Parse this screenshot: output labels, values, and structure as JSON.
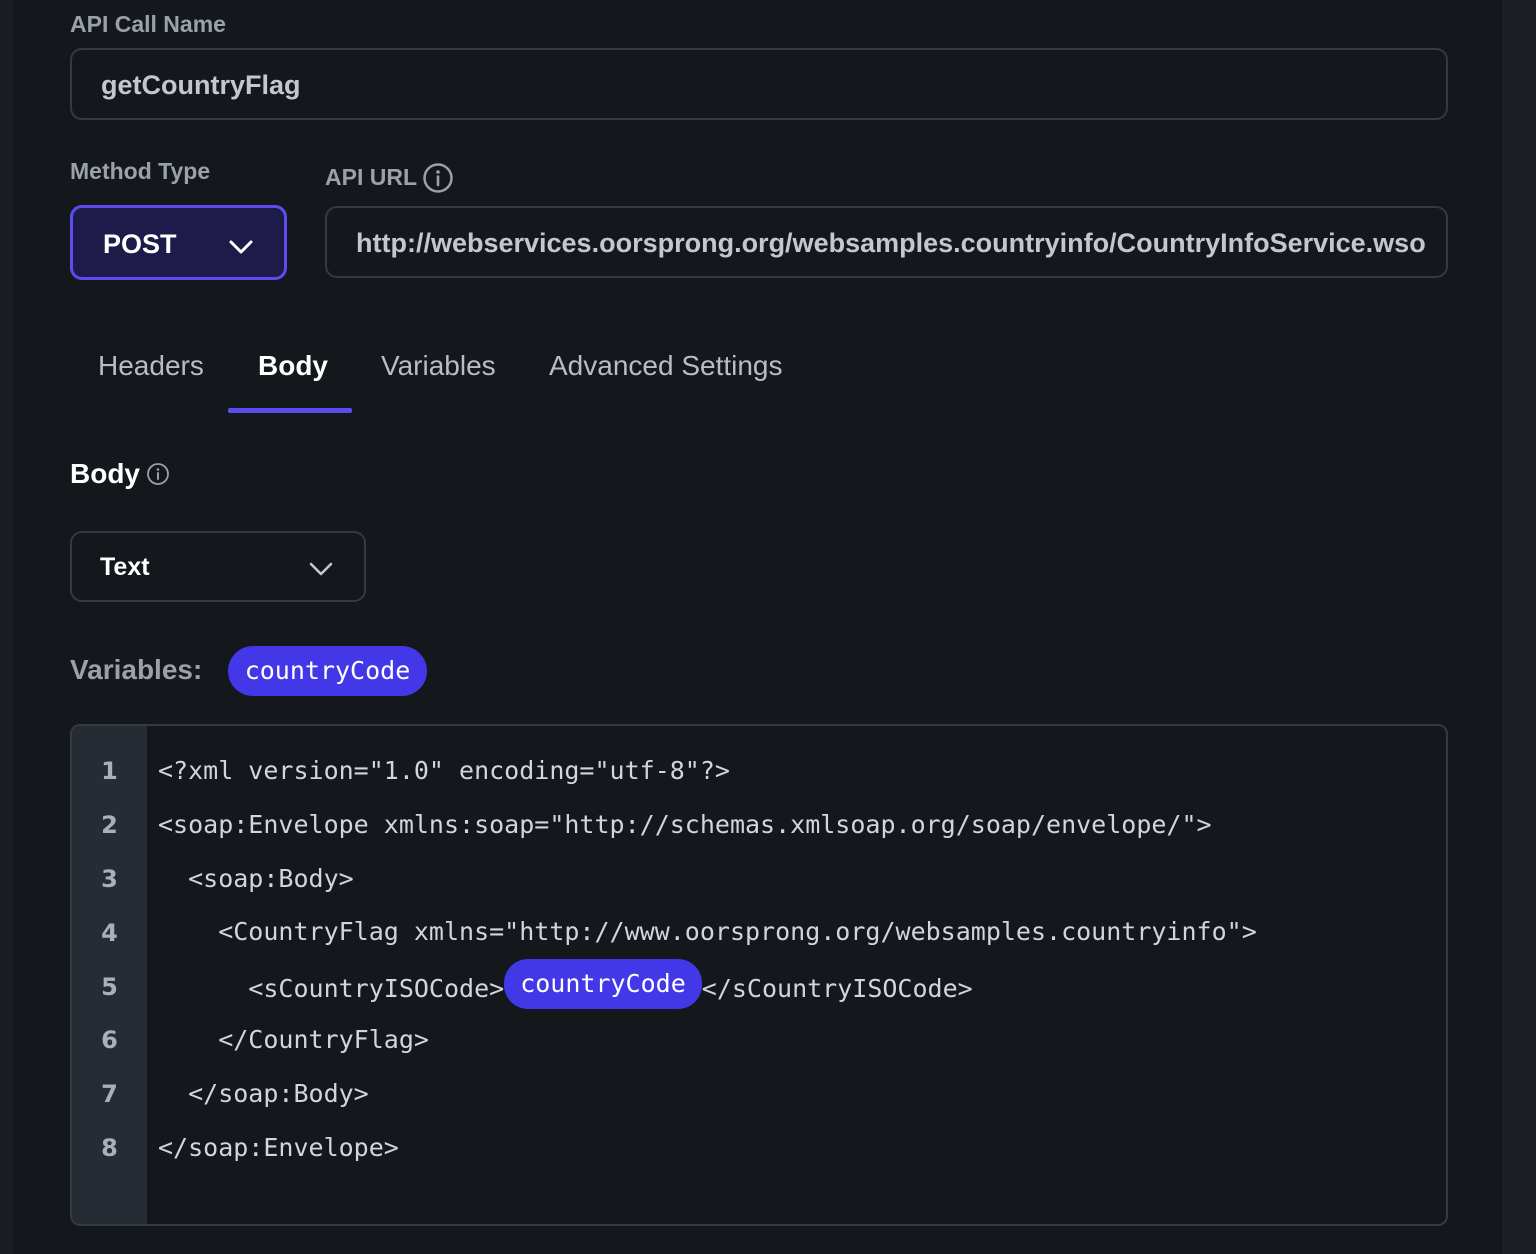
{
  "form": {
    "api_call_name_label": "API Call Name",
    "api_call_name_value": "getCountryFlag",
    "method_type_label": "Method Type",
    "method_type_value": "POST",
    "api_url_label": "API URL",
    "api_url_value": "http://webservices.oorsprong.org/websamples.countryinfo/CountryInfoService.wso"
  },
  "tabs": [
    {
      "label": "Headers",
      "active": false
    },
    {
      "label": "Body",
      "active": true
    },
    {
      "label": "Variables",
      "active": false
    },
    {
      "label": "Advanced Settings",
      "active": false
    }
  ],
  "body_section": {
    "title": "Body",
    "type_value": "Text",
    "variables_label": "Variables:",
    "variables": [
      "countryCode"
    ]
  },
  "editor": {
    "line_numbers": [
      "1",
      "2",
      "3",
      "4",
      "5",
      "6",
      "7",
      "8"
    ],
    "lines": [
      "<?xml version=\"1.0\" encoding=\"utf-8\"?>",
      "<soap:Envelope xmlns:soap=\"http://schemas.xmlsoap.org/soap/envelope/\">",
      "  <soap:Body>",
      "    <CountryFlag xmlns=\"http://www.oorsprong.org/websamples.countryinfo\">",
      "      <sCountryISOCode>",
      "    </CountryFlag>",
      "  </soap:Body>",
      "</soap:Envelope>"
    ],
    "line5_variable": "countryCode",
    "line5_suffix": "</sCountryISOCode>"
  },
  "colors": {
    "background": "#14181d",
    "accent": "#5b4df0",
    "chip": "#4338e8",
    "border": "#343a42"
  }
}
